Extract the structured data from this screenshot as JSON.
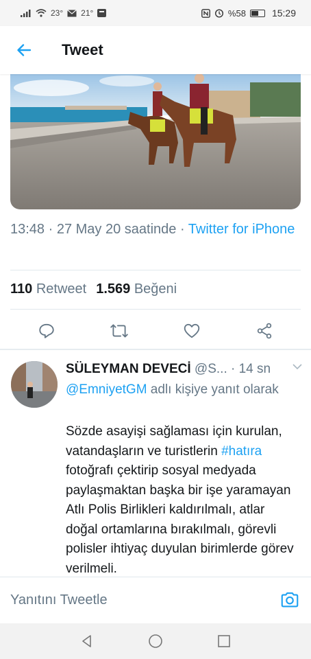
{
  "status_bar": {
    "temp1": "23°",
    "temp2": "21°",
    "battery": "%58",
    "battery_level": 0.58,
    "time": "15:29"
  },
  "header": {
    "title": "Tweet"
  },
  "tweet": {
    "timestamp": "13:48 · 27 May 20 saatinde · ",
    "source": "Twitter for iPhone",
    "retweet_count": "110",
    "retweet_label": "Retweet",
    "like_count": "1.569",
    "like_label": "Beğeni"
  },
  "actions": [
    "reply-icon",
    "retweet-icon",
    "like-icon",
    "share-icon"
  ],
  "reply": {
    "name": "SÜLEYMAN DEVECİ",
    "handle": "@S...",
    "time": "· 14 sn",
    "reply_to_handle": "@EmniyetGM",
    "reply_to_suffix": " adlı kişiye yanıt olarak",
    "text_before_tag": "Sözde asayişi sağlaması için kurulan, vatandaşların ve turistlerin ",
    "hashtag": "#hatıra",
    "text_after_tag": " fotoğrafı çektirip sosyal medyada paylaşmaktan başka bir işe yaramayan Atlı Polis Birlikleri kaldırılmalı, atlar doğal ortamlarına bırakılmalı, görevli polisler ihtiyaç duyulan birimlerde görev verilmeli."
  },
  "composer": {
    "placeholder": "Yanıtını Tweetle"
  },
  "colors": {
    "accent": "#1da1f2",
    "secondary_text": "#657786",
    "divider": "#e1e8ed"
  }
}
